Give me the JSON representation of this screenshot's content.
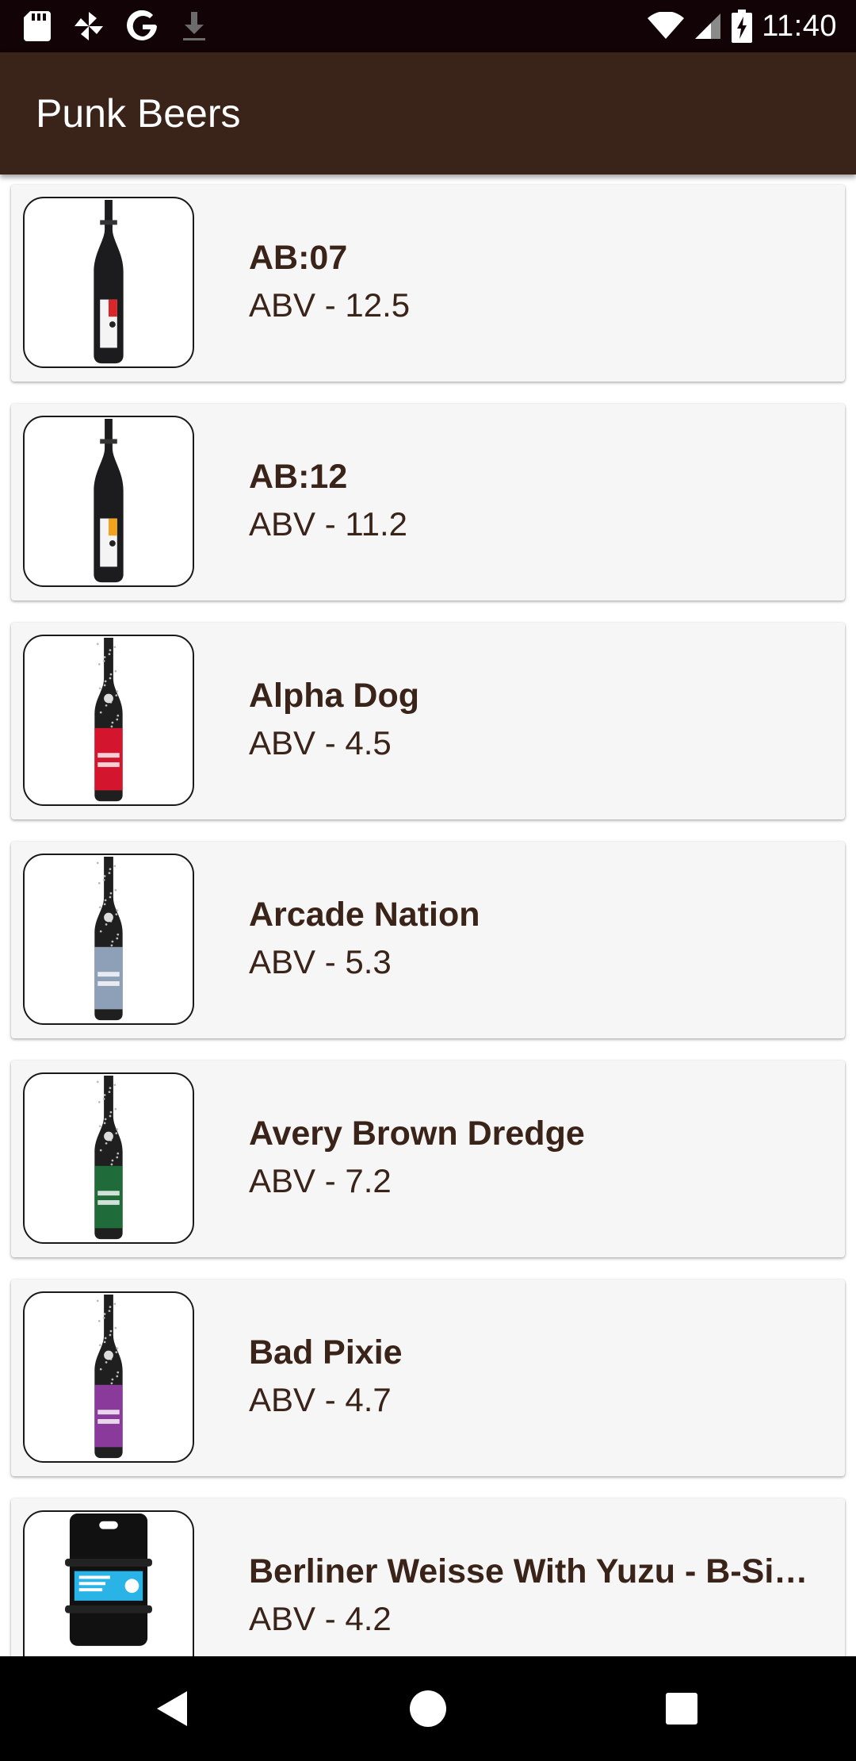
{
  "status_bar": {
    "time": "11:40",
    "left_icons": [
      "sd-card-icon",
      "pinwheel-icon",
      "google-icon",
      "download-icon"
    ],
    "right_icons": [
      "wifi-icon",
      "signal-icon",
      "battery-charging-icon"
    ]
  },
  "app_bar": {
    "title": "Punk Beers"
  },
  "beers": [
    {
      "name": "AB:07",
      "abv": "ABV - 12.5",
      "bottle": "large",
      "label_color": "#d8262b"
    },
    {
      "name": "AB:12",
      "abv": "ABV - 11.2",
      "bottle": "large",
      "label_color": "#f0a11e"
    },
    {
      "name": "Alpha Dog",
      "abv": "ABV - 4.5",
      "bottle": "small",
      "label_color": "#d3162e"
    },
    {
      "name": "Arcade Nation",
      "abv": "ABV - 5.3",
      "bottle": "small",
      "label_color": "#8ea0b8"
    },
    {
      "name": "Avery Brown Dredge",
      "abv": "ABV - 7.2",
      "bottle": "small",
      "label_color": "#1f6b3a"
    },
    {
      "name": "Bad Pixie",
      "abv": "ABV - 4.7",
      "bottle": "small",
      "label_color": "#8a3a9a"
    },
    {
      "name": "Berliner Weisse With Yuzu - B-Sid…",
      "abv": "ABV - 4.2",
      "bottle": "keg",
      "label_color": "#29b3e6"
    }
  ],
  "nav_bar": {
    "buttons": [
      "back-icon",
      "home-icon",
      "recents-icon"
    ]
  }
}
